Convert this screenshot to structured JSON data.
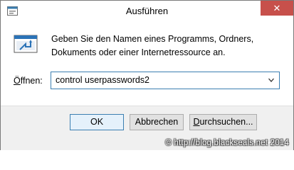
{
  "window": {
    "title": "Ausführen",
    "close_label": "✕"
  },
  "content": {
    "description_line1": "Geben Sie den Namen eines Programms, Ordners,",
    "description_line2": "Dokuments oder einer Internetressource an.",
    "open_label_prefix": "",
    "open_label_underlined": "Ö",
    "open_label_suffix": "ffnen:",
    "input_value": "control userpasswords2"
  },
  "buttons": {
    "ok": "OK",
    "cancel": "Abbrechen",
    "browse_underlined": "D",
    "browse_rest": "urchsuchen..."
  },
  "watermark": "© http://blog.blackseals.net 2014",
  "colors": {
    "close_button": "#c7504b",
    "focus_border": "#3c7fb1",
    "footer_bg": "#f0f0f0"
  },
  "icons": {
    "title": "run-window-icon",
    "content": "run-dialog-icon",
    "dropdown": "chevron-down-icon"
  }
}
